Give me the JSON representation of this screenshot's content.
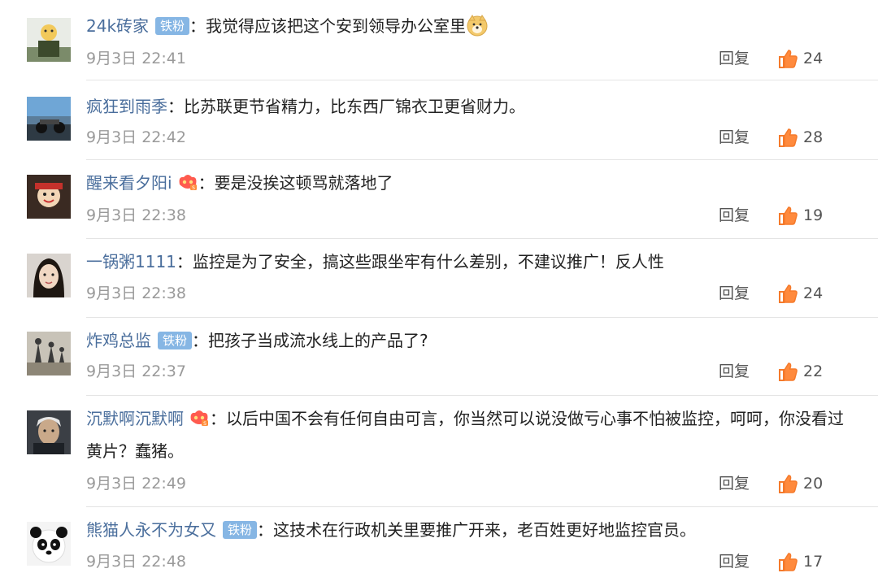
{
  "comments": [
    {
      "username": "24k砖家",
      "badge": "铁粉",
      "colon": "：",
      "text": "我觉得应该把这个安到领导办公室里",
      "time": "9月3日 22:41",
      "reply": "回复",
      "likes": "24",
      "avatar": "avatar-person-icon"
    },
    {
      "username": "疯狂到雨季",
      "colon": "：",
      "text": "比苏联更节省精力，比东西厂锦衣卫更省财力。",
      "time": "9月3日 22:42",
      "reply": "回复",
      "likes": "28",
      "avatar": "avatar-motorcycle-icon"
    },
    {
      "username": "醒来看夕阳i",
      "colon": "：",
      "text": "要是没挨这顿骂就落地了",
      "time": "9月3日 22:38",
      "reply": "回复",
      "likes": "19",
      "avatar": "avatar-doll-icon"
    },
    {
      "username": "一锅粥1111",
      "colon": "：",
      "text": "监控是为了安全，搞这些跟坐牢有什么差别，不建议推广！反人性",
      "time": "9月3日 22:38",
      "reply": "回复",
      "likes": "24",
      "avatar": "avatar-girl-icon"
    },
    {
      "username": "炸鸡总监",
      "badge": "铁粉",
      "colon": "：",
      "text": "把孩子当成流水线上的产品了?",
      "time": "9月3日 22:37",
      "reply": "回复",
      "likes": "22",
      "avatar": "avatar-shadows-icon"
    },
    {
      "username": "沉默啊沉默啊",
      "colon": "：",
      "text": "以后中国不会有任何自由可言，你当然可以说没做亏心事不怕被监控，呵呵，你没看过黄片？蠢猪。",
      "time": "9月3日 22:49",
      "reply": "回复",
      "likes": "20",
      "avatar": "avatar-painting-icon"
    },
    {
      "username": "熊猫人永不为女又",
      "badge": "铁粉",
      "colon": "：",
      "text": "这技术在行政机关里要推广开来，老百姓更好地监控官员。",
      "time": "9月3日 22:48",
      "reply": "回复",
      "likes": "17",
      "avatar": "avatar-panda-icon"
    }
  ]
}
